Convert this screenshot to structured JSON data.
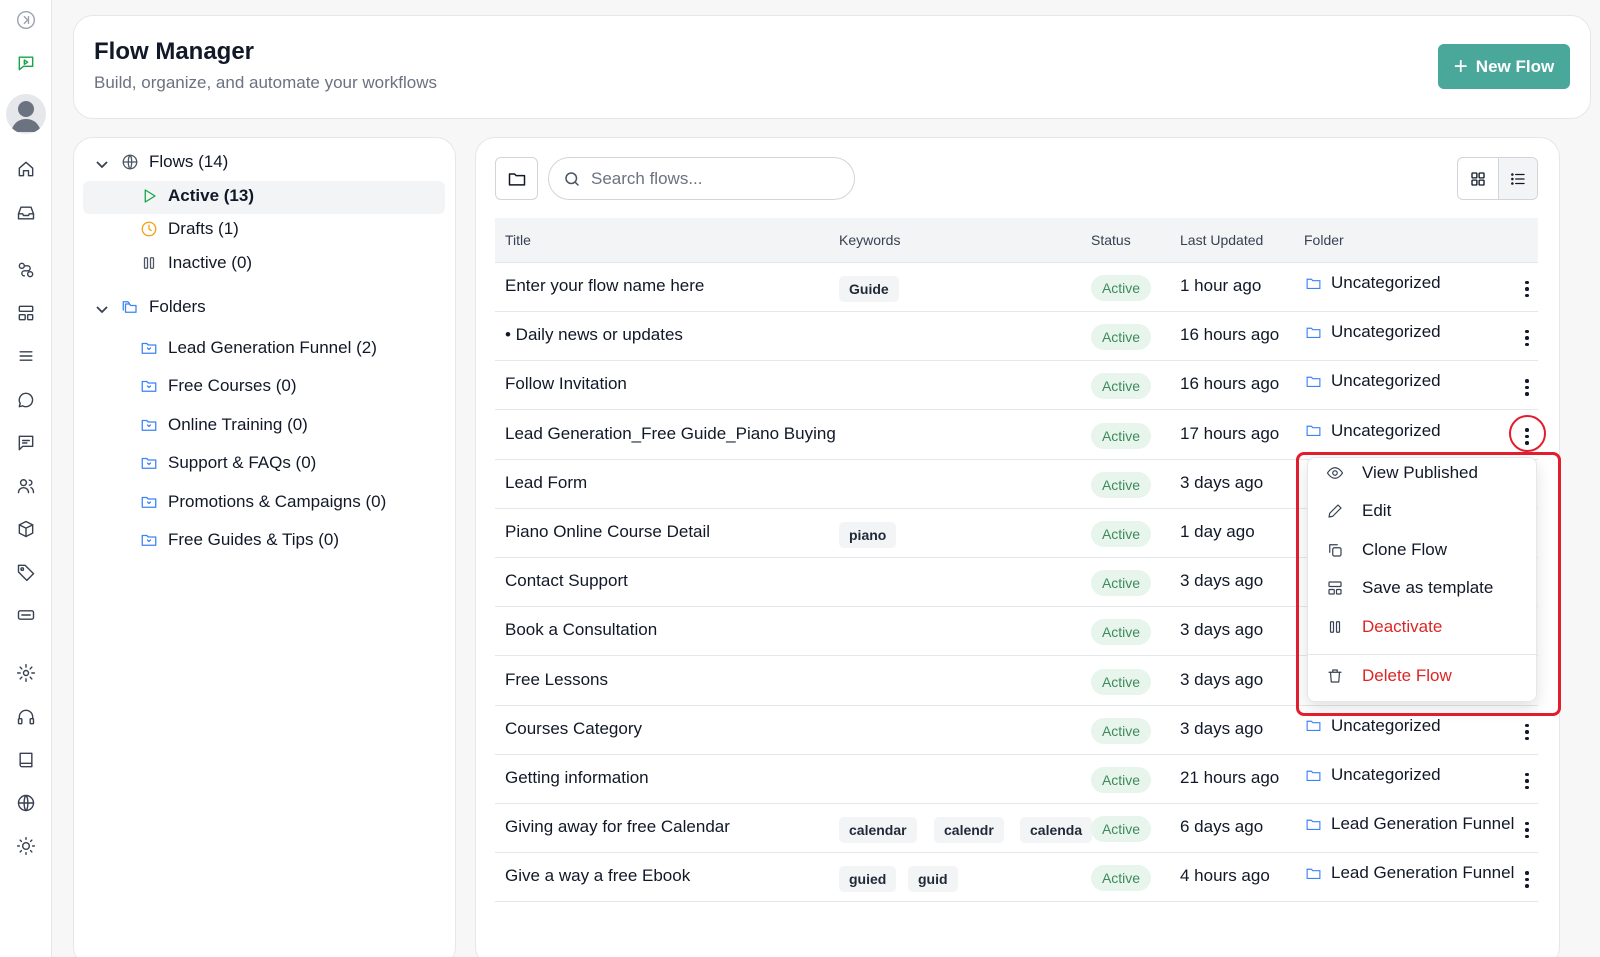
{
  "rail": {
    "icons": [
      "sidebar-toggle-icon",
      "chatbot-icon",
      "avatar",
      "home-icon",
      "inbox-icon",
      "flows-icon",
      "templates-icon",
      "list-icon",
      "chat-icon",
      "messages-icon",
      "contacts-icon",
      "package-icon",
      "tag-icon",
      "ticket-icon",
      "settings-icon",
      "support-icon",
      "book-icon",
      "globe-icon",
      "theme-icon"
    ]
  },
  "header": {
    "title": "Flow Manager",
    "subtitle": "Build, organize, and automate your workflows",
    "new_flow_label": "New Flow"
  },
  "sidebar": {
    "flows_label": "Flows (14)",
    "statuses": [
      {
        "label": "Active (13)",
        "icon": "play-icon",
        "color": "#16a34a"
      },
      {
        "label": "Drafts (1)",
        "icon": "clock-icon",
        "color": "#f59e0b"
      },
      {
        "label": "Inactive (0)",
        "icon": "pause-icon",
        "color": "#4b5563"
      }
    ],
    "folders_label": "Folders",
    "folders": [
      {
        "label": "Lead Generation Funnel (2)"
      },
      {
        "label": "Free Courses (0)"
      },
      {
        "label": "Online Training (0)"
      },
      {
        "label": "Support & FAQs (0)"
      },
      {
        "label": "Promotions & Campaigns (0)"
      },
      {
        "label": "Free Guides & Tips (0)"
      }
    ]
  },
  "toolbar": {
    "search_placeholder": "Search flows..."
  },
  "table": {
    "headers": {
      "title": "Title",
      "keywords": "Keywords",
      "status": "Status",
      "updated": "Last Updated",
      "folder": "Folder"
    },
    "rows": [
      {
        "title": "Enter your flow name here",
        "keywords": [
          "Guide"
        ],
        "status": "Active",
        "updated": "1 hour ago",
        "folder": "Uncategorized"
      },
      {
        "title": "• Daily news or updates",
        "keywords": [],
        "status": "Active",
        "updated": "16 hours ago",
        "folder": "Uncategorized"
      },
      {
        "title": "Follow Invitation",
        "keywords": [],
        "status": "Active",
        "updated": "16 hours ago",
        "folder": "Uncategorized"
      },
      {
        "title": "Lead Generation_Free Guide_Piano Buying",
        "keywords": [],
        "status": "Active",
        "updated": "17 hours ago",
        "folder": "Uncategorized"
      },
      {
        "title": "Lead Form",
        "keywords": [],
        "status": "Active",
        "updated": "3 days ago",
        "folder": ""
      },
      {
        "title": "Piano Online Course Detail",
        "keywords": [
          "piano"
        ],
        "status": "Active",
        "updated": "1 day ago",
        "folder": ""
      },
      {
        "title": "Contact Support",
        "keywords": [],
        "status": "Active",
        "updated": "3 days ago",
        "folder": ""
      },
      {
        "title": "Book a Consultation",
        "keywords": [],
        "status": "Active",
        "updated": "3 days ago",
        "folder": ""
      },
      {
        "title": "Free Lessons",
        "keywords": [],
        "status": "Active",
        "updated": "3 days ago",
        "folder": ""
      },
      {
        "title": "Courses Category",
        "keywords": [],
        "status": "Active",
        "updated": "3 days ago",
        "folder": "Uncategorized"
      },
      {
        "title": "Getting information",
        "keywords": [],
        "status": "Active",
        "updated": "21 hours ago",
        "folder": "Uncategorized"
      },
      {
        "title": "Giving away for free Calendar",
        "keywords": [
          "calendar",
          "calendr",
          "calenda"
        ],
        "status": "Active",
        "updated": "6 days ago",
        "folder": "Lead Generation Funnel"
      },
      {
        "title": "Give a way a free Ebook",
        "keywords": [
          "guied",
          "guid"
        ],
        "status": "Active",
        "updated": "4 hours ago",
        "folder": "Lead Generation Funnel"
      }
    ]
  },
  "context_menu": {
    "items": [
      {
        "label": "View Published",
        "icon": "eye-icon",
        "danger": false
      },
      {
        "label": "Edit",
        "icon": "pencil-icon",
        "danger": false
      },
      {
        "label": "Clone Flow",
        "icon": "copy-icon",
        "danger": false
      },
      {
        "label": "Save as template",
        "icon": "template-icon",
        "danger": false
      },
      {
        "label": "Deactivate",
        "icon": "pause-icon",
        "danger": true
      },
      {
        "label": "Delete Flow",
        "icon": "trash-icon",
        "danger": true
      }
    ]
  },
  "colors": {
    "accent": "#4aa89a",
    "danger": "#dc2626",
    "active_badge_bg": "#e7f5ec",
    "active_badge_text": "#3f8a5c",
    "folder_icon": "#3b82f6"
  }
}
